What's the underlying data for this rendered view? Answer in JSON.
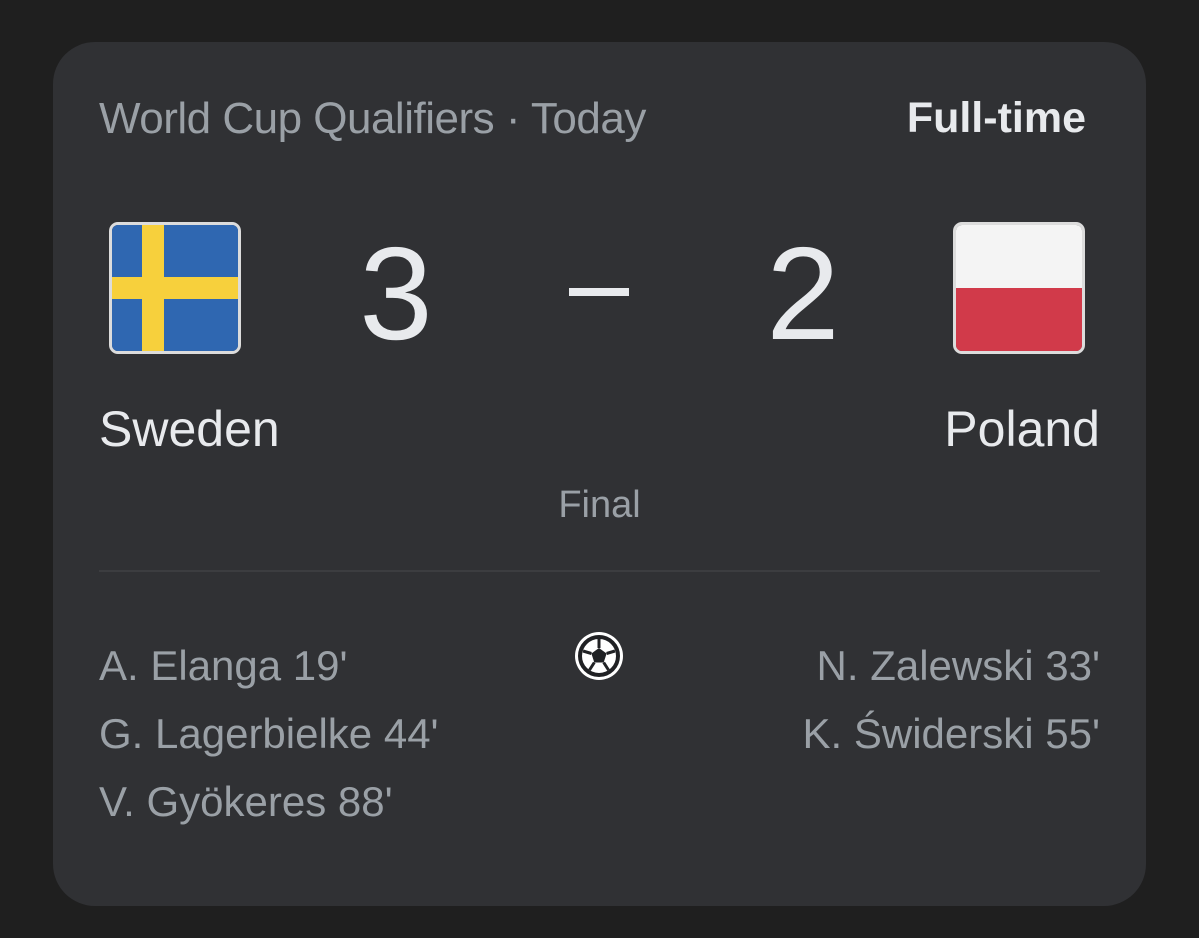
{
  "header": {
    "competition": "World Cup Qualifiers · Today",
    "state": "Full-time"
  },
  "home": {
    "name": "Sweden",
    "score": "3",
    "flag_icon": "sweden-flag-icon",
    "flag_colors": {
      "blue": "#2f67b1",
      "yellow": "#f7d03c"
    },
    "scorers": [
      "A. Elanga 19'",
      "G. Lagerbielke 44'",
      "V. Gyökeres 88'"
    ]
  },
  "away": {
    "name": "Poland",
    "score": "2",
    "flag_icon": "poland-flag-icon",
    "flag_colors": {
      "white": "#f4f4f4",
      "red": "#d13a4a"
    },
    "scorers": [
      "N. Zalewski 33'",
      "K. Świderski 55'"
    ]
  },
  "status": "Final",
  "goal_icon": "soccer-ball-icon"
}
